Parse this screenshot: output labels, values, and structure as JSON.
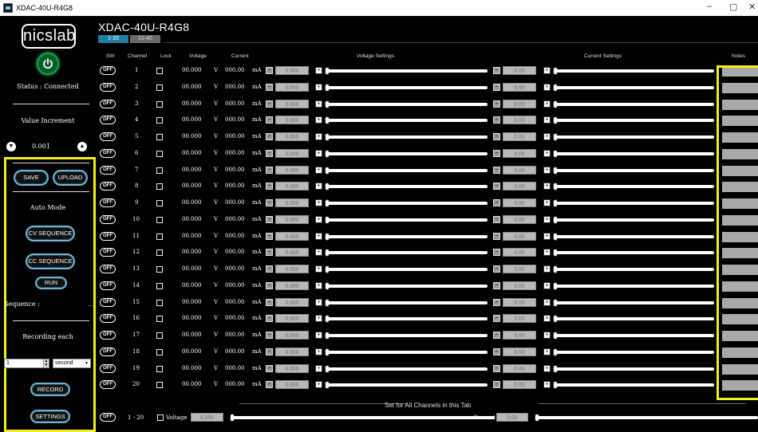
{
  "window": {
    "title": "XDAC-40U-R4G8",
    "controls": [
      "–",
      "▢",
      "✕"
    ]
  },
  "sidebar": {
    "logo": "nicslab",
    "status": "Status : Connected",
    "value_increment_label": "Value Increment",
    "increment_value": "0.001",
    "save_label": "SAVE",
    "upload_label": "UPLOAD",
    "auto_mode_label": "Auto Mode",
    "cv_sequence_label": "CV SEQUENCE",
    "cc_sequence_label": "CC SEQUENCE",
    "run_label": "RUN",
    "sequence_label": "Sequence :",
    "sequence_value": "...",
    "recording_label": "Recording each",
    "recording_value": "1",
    "recording_unit": "second",
    "record_label": "RECORD",
    "settings_label": "SETTINGS"
  },
  "main": {
    "title": "XDAC-40U-R4G8",
    "tabs": [
      {
        "label": "1-20",
        "active": true
      },
      {
        "label": "21-40",
        "active": false
      }
    ],
    "headers": {
      "sw": "SW",
      "channel": "Channel",
      "lock": "Lock",
      "voltage": "Voltage",
      "current": "Current",
      "voltage_settings": "Voltage Settings",
      "current_settings": "Current Settings",
      "notes": "Notes"
    },
    "rows": [
      {
        "sw": "OFF",
        "channel": "1",
        "voltage": "00.000",
        "v_unit": "V",
        "current": "000.00",
        "c_unit": "mA",
        "v_set": "0.000",
        "c_set": "0.00"
      },
      {
        "sw": "OFF",
        "channel": "2",
        "voltage": "00.000",
        "v_unit": "V",
        "current": "000.00",
        "c_unit": "mA",
        "v_set": "0.000",
        "c_set": "0.00"
      },
      {
        "sw": "OFF",
        "channel": "3",
        "voltage": "00.000",
        "v_unit": "V",
        "current": "000.00",
        "c_unit": "mA",
        "v_set": "0.000",
        "c_set": "0.00"
      },
      {
        "sw": "OFF",
        "channel": "4",
        "voltage": "00.000",
        "v_unit": "V",
        "current": "000.00",
        "c_unit": "mA",
        "v_set": "0.000",
        "c_set": "0.00"
      },
      {
        "sw": "OFF",
        "channel": "5",
        "voltage": "00.000",
        "v_unit": "V",
        "current": "000.00",
        "c_unit": "mA",
        "v_set": "0.000",
        "c_set": "0.00"
      },
      {
        "sw": "OFF",
        "channel": "6",
        "voltage": "00.000",
        "v_unit": "V",
        "current": "000.00",
        "c_unit": "mA",
        "v_set": "0.000",
        "c_set": "0.00"
      },
      {
        "sw": "OFF",
        "channel": "7",
        "voltage": "00.000",
        "v_unit": "V",
        "current": "000.00",
        "c_unit": "mA",
        "v_set": "0.000",
        "c_set": "0.00"
      },
      {
        "sw": "OFF",
        "channel": "8",
        "voltage": "00.000",
        "v_unit": "V",
        "current": "000.00",
        "c_unit": "mA",
        "v_set": "0.000",
        "c_set": "0.00"
      },
      {
        "sw": "OFF",
        "channel": "9",
        "voltage": "00.000",
        "v_unit": "V",
        "current": "000.00",
        "c_unit": "mA",
        "v_set": "0.000",
        "c_set": "0.00"
      },
      {
        "sw": "OFF",
        "channel": "10",
        "voltage": "00.000",
        "v_unit": "V",
        "current": "000.00",
        "c_unit": "mA",
        "v_set": "0.000",
        "c_set": "0.00"
      },
      {
        "sw": "OFF",
        "channel": "11",
        "voltage": "00.000",
        "v_unit": "V",
        "current": "000.00",
        "c_unit": "mA",
        "v_set": "0.000",
        "c_set": "0.00"
      },
      {
        "sw": "OFF",
        "channel": "12",
        "voltage": "00.000",
        "v_unit": "V",
        "current": "000.00",
        "c_unit": "mA",
        "v_set": "0.000",
        "c_set": "0.00"
      },
      {
        "sw": "OFF",
        "channel": "13",
        "voltage": "00.000",
        "v_unit": "V",
        "current": "000.00",
        "c_unit": "mA",
        "v_set": "0.000",
        "c_set": "0.00"
      },
      {
        "sw": "OFF",
        "channel": "14",
        "voltage": "00.000",
        "v_unit": "V",
        "current": "000.00",
        "c_unit": "mA",
        "v_set": "0.000",
        "c_set": "0.00"
      },
      {
        "sw": "OFF",
        "channel": "15",
        "voltage": "00.000",
        "v_unit": "V",
        "current": "000.00",
        "c_unit": "mA",
        "v_set": "0.000",
        "c_set": "0.00"
      },
      {
        "sw": "OFF",
        "channel": "16",
        "voltage": "00.000",
        "v_unit": "V",
        "current": "000.00",
        "c_unit": "mA",
        "v_set": "0.000",
        "c_set": "0.00"
      },
      {
        "sw": "OFF",
        "channel": "17",
        "voltage": "00.000",
        "v_unit": "V",
        "current": "000.00",
        "c_unit": "mA",
        "v_set": "0.000",
        "c_set": "0.00"
      },
      {
        "sw": "OFF",
        "channel": "18",
        "voltage": "00.000",
        "v_unit": "V",
        "current": "000.00",
        "c_unit": "mA",
        "v_set": "0.000",
        "c_set": "0.00"
      },
      {
        "sw": "OFF",
        "channel": "19",
        "voltage": "00.000",
        "v_unit": "V",
        "current": "000.00",
        "c_unit": "mA",
        "v_set": "0.000",
        "c_set": "0.00"
      },
      {
        "sw": "OFF",
        "channel": "20",
        "voltage": "00.000",
        "v_unit": "V",
        "current": "000.00",
        "c_unit": "mA",
        "v_set": "0.000",
        "c_set": "0.00"
      }
    ],
    "set_all": {
      "label": "Set for All Channels in this Tab",
      "sw": "OFF",
      "range": "1 - 20",
      "voltage_label": "Voltage",
      "voltage_value": "0.000",
      "current_label": "Current",
      "current_value": "0.00"
    }
  },
  "colors": {
    "highlight": "#f2ef1a",
    "tab_active": "#1f7ea3",
    "power_on": "#2ddc6a",
    "button_border": "#6fb5d0"
  },
  "icons": {
    "app": "app-icon",
    "power": "power-icon",
    "decrease": "arrow-down-circle-icon",
    "increase": "arrow-up-circle-icon"
  }
}
